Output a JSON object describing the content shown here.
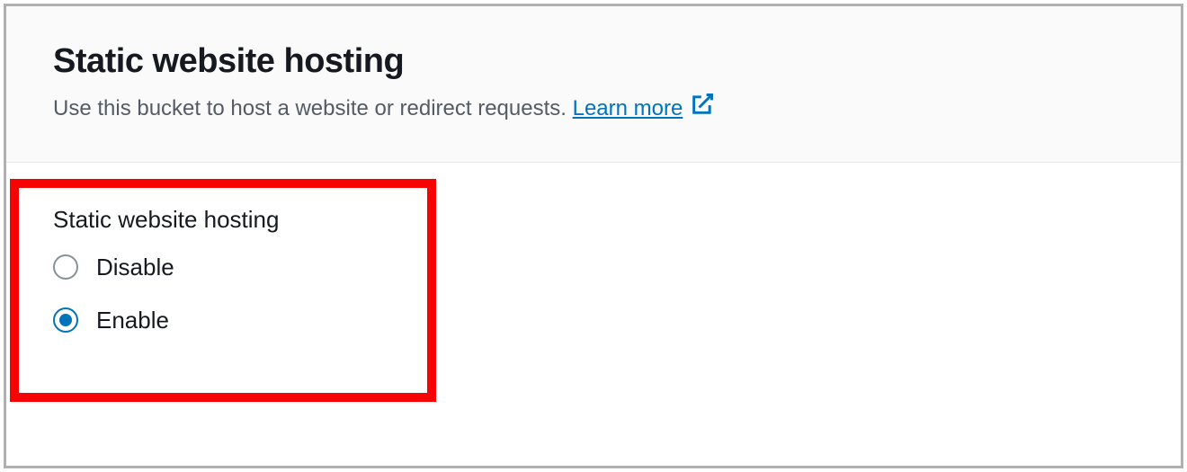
{
  "header": {
    "title": "Static website hosting",
    "subtitle_prefix": "Use this bucket to host a website or redirect requests. ",
    "learn_more_label": "Learn more "
  },
  "radio_group": {
    "label": "Static website hosting",
    "options": {
      "disable": "Disable",
      "enable": "Enable"
    },
    "selected": "enable"
  }
}
